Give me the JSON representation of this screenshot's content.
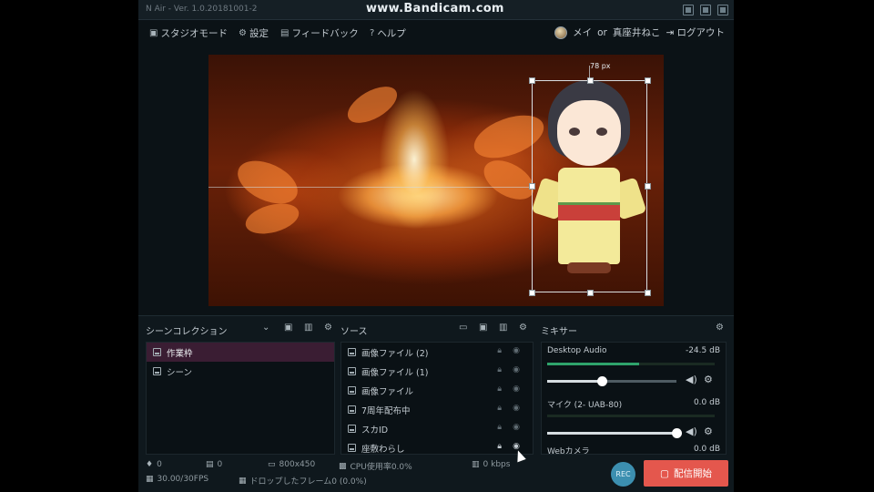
{
  "overlay": {
    "watermark": "www.Bandicam.com"
  },
  "window": {
    "title": "N Air - Ver. 1.0.20181001-2"
  },
  "menu": {
    "studio_mode": "スタジオモード",
    "settings": "設定",
    "feedback": "フィードバック",
    "help": "ヘルプ",
    "user_name": "メイ",
    "or": "or",
    "user_name2": "真座井ねこ",
    "logout": "ログアウト"
  },
  "preview": {
    "distance_label": "78 px"
  },
  "scenes": {
    "header": "シーンコレクション",
    "items": [
      {
        "label": "作業枠",
        "active": true
      },
      {
        "label": "シーン",
        "active": false
      }
    ]
  },
  "sources": {
    "header": "ソース",
    "items": [
      {
        "label": "画像ファイル (2)"
      },
      {
        "label": "画像ファイル (1)"
      },
      {
        "label": "画像ファイル"
      },
      {
        "label": "7周年配布中"
      },
      {
        "label": "スカID"
      },
      {
        "label": "座敷わらし"
      }
    ]
  },
  "mixer": {
    "header": "ミキサー",
    "sources": [
      {
        "name": "Desktop Audio",
        "db": "-24.5 dB",
        "volume": 0.42,
        "meter": 0.55
      },
      {
        "name": "マイク (2- UAB-80)",
        "db": "0.0 dB",
        "volume": 1.0,
        "meter": 0.0
      },
      {
        "name": "Webカメラ",
        "db": "0.0 dB",
        "volume": 1.0,
        "meter": 0.0
      }
    ]
  },
  "status": {
    "comments": "0",
    "messages": "0",
    "resolution": "800x450",
    "cpu": "CPU使用率0.0%",
    "bitrate": "0 kbps",
    "fps": "30.00/30FPS",
    "dropped": "ドロップしたフレーム0 (0.0%)",
    "rec": "REC",
    "start_stream": "配信開始"
  },
  "colors": {
    "accent_red": "#e4574d",
    "rec_blue": "#3c8fb0",
    "active_scene": "#3a1d33"
  }
}
